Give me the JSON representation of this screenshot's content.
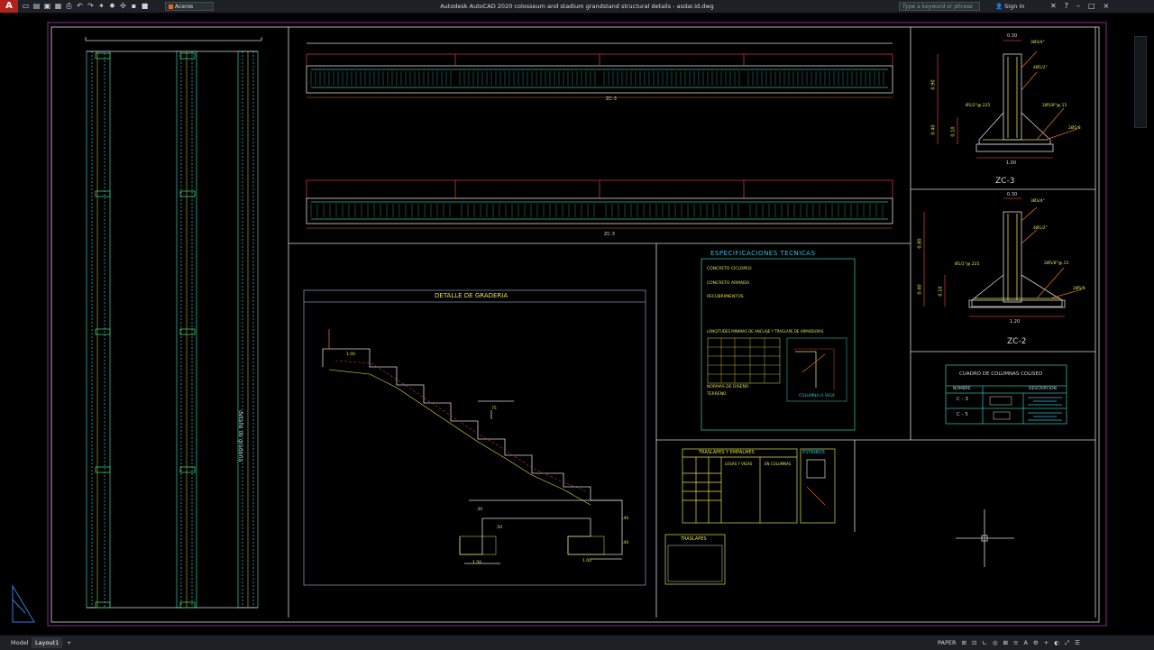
{
  "titlebar": {
    "app_letter": "A",
    "title": "Autodesk AutoCAD 2020   colosseum and stadium grandstand structural details - asdar.id.dwg",
    "layer_name": "Aceros",
    "search_placeholder": "Type a keyword or phrase",
    "sign_in": "Sign In",
    "quick_access_icons": [
      "new-icon",
      "open-icon",
      "save-icon",
      "saveas-icon",
      "plot-icon",
      "undo-icon",
      "redo-icon",
      "layer-icons"
    ],
    "right_icons": [
      "exchange-icon",
      "help-icon",
      "minimize-icon",
      "maximize-icon",
      "close-icon"
    ]
  },
  "drawing": {
    "sections": {
      "beam_top": "ZC-3",
      "beam_bottom": "ZC-3",
      "vertical_label": "detalle de graderia"
    },
    "graderia": {
      "title": "DETALLE DE GRADERIA",
      "dims": [
        "1.00",
        "75",
        "1.50",
        ".30",
        ".50",
        "1.00",
        ".40",
        ".40"
      ]
    },
    "specs": {
      "title": "ESPECIFICACIONES TECNICAS",
      "lines": [
        "CONCRETO CICLOPEO",
        "CONCRETO ARMADO",
        "RECUBRIMIENTOS",
        "LONGITUDES MINIMAS DE ANCLAJE Y TRASLAPE DE ARMADURAS",
        "NORMAS DE DISEÑO",
        "TERRENO"
      ],
      "column_caption": "COLUMNA O VIGA"
    },
    "footing_zc3": {
      "label": "ZC-3",
      "dims": [
        "0.30",
        "3Ø3/4\"",
        "4Ø1/2\"",
        "0.90",
        "0.40",
        "0.10",
        "Ø1/2\"@.225",
        "2Ø5/8\"@.15",
        "2Ø5/8",
        "1.00"
      ]
    },
    "footing_zc2": {
      "label": "ZC-2",
      "dims": [
        "0.30",
        "3Ø3/4\"",
        "4Ø1/2\"",
        "0.80",
        "0.40",
        "0.10",
        "Ø1/2\"@.225",
        "2Ø5/8\"@.15",
        "2Ø5/8",
        "1.20"
      ]
    },
    "cuadro": {
      "title": "CUADRO DE COLUMNAS COLISEO",
      "headers": [
        "NOMBRE",
        "DESCRIPCION"
      ],
      "rows": [
        "C - 3",
        "C - 5"
      ]
    },
    "traslapes": {
      "title": "TRASLAPES Y EMPALMES",
      "estribos": "ESTRIBOS",
      "cols": [
        "LOSAS Y VIGAS",
        "EN COLUMNAS"
      ]
    },
    "traslapes_small": {
      "title": "TRASLAPES"
    }
  },
  "statusbar": {
    "tabs": [
      "Model",
      "Layout1",
      "+"
    ],
    "right_items": [
      "PAPER",
      "grid-icon",
      "snap-icon",
      "ortho-icon",
      "polar-icon",
      "osnap-icon",
      "lineweight-icon",
      "annotation-icon",
      "workspace-icon",
      "plus-icon",
      "isolate-icon",
      "fullscreen-icon",
      "customize-icon"
    ]
  }
}
